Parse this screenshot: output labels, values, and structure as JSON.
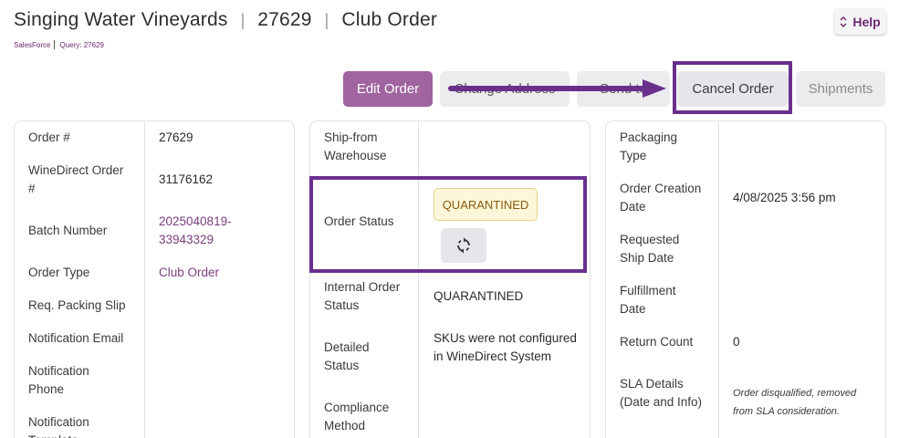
{
  "header": {
    "winery": "Singing Water Vineyards",
    "order_id": "27629",
    "order_kind": "Club Order",
    "source": "SalesForce",
    "query": "Query: 27629"
  },
  "help": {
    "label": "Help"
  },
  "actions": {
    "edit": "Edit Order",
    "change_address": "Change Address",
    "send_to": "Send to",
    "cancel": "Cancel Order",
    "shipments": "Shipments"
  },
  "col1": {
    "order_num_label": "Order #",
    "order_num": "27629",
    "winedirect_label": "WineDirect Order #",
    "winedirect": "31176162",
    "batch_label": "Batch Number",
    "batch": "2025040819-33943329",
    "type_label": "Order Type",
    "type": "Club Order",
    "packing_label": "Req. Packing Slip",
    "email_label": "Notification Email",
    "phone_label": "Notification Phone",
    "template_label": "Notification Template"
  },
  "col2": {
    "warehouse_label": "Ship-from Warehouse",
    "status_label": "Order Status",
    "status": "QUARANTINED",
    "internal_label": "Internal Order Status",
    "internal": "QUARANTINED",
    "detailed_label": "Detailed Status",
    "detailed": "SKUs were not configured in WineDirect System",
    "compliance_label": "Compliance Method"
  },
  "col3": {
    "packaging_label": "Packaging Type",
    "created_label": "Order Creation Date",
    "created": "4/08/2025 3:56 pm",
    "requested_label": "Requested Ship Date",
    "fulfillment_label": "Fulfillment Date",
    "return_label": "Return Count",
    "return": "0",
    "sla_label": "SLA Details (Date and Info)",
    "sla": "Order disqualified, removed from SLA consideration."
  },
  "colors": {
    "accent": "#6b2a6e",
    "highlight": "#6a2f8d",
    "edit_bg": "#a0649f",
    "badge_bg": "#fdf6d8"
  }
}
